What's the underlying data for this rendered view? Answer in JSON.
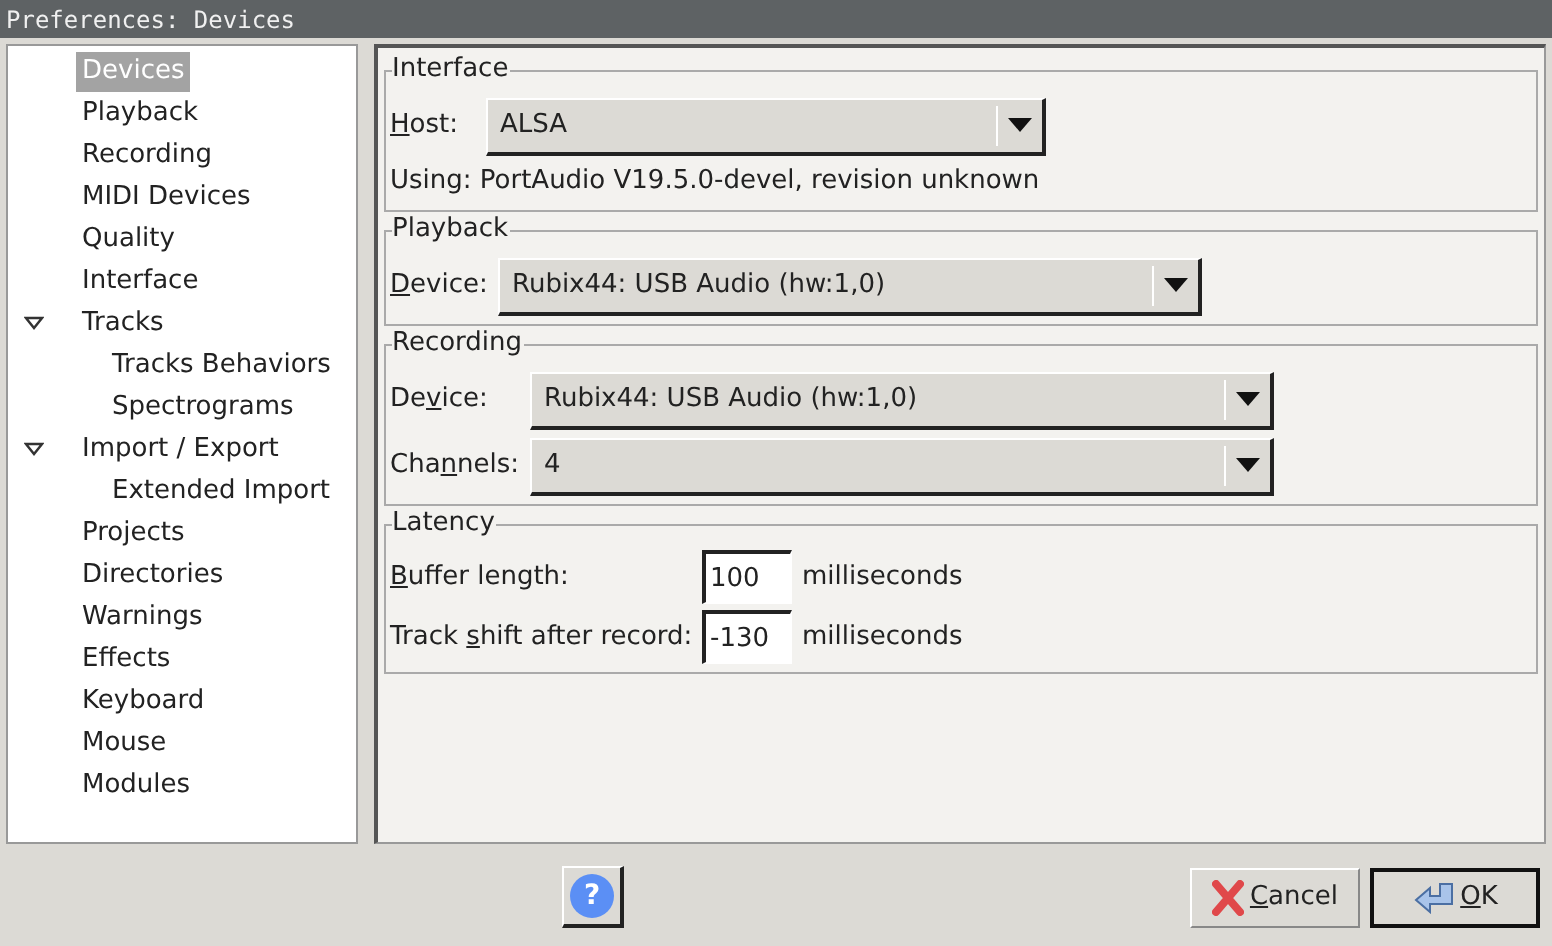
{
  "window": {
    "title": "Preferences: Devices"
  },
  "sidebar": {
    "items": [
      {
        "label": "Devices",
        "selected": true
      },
      {
        "label": "Playback",
        "selected": false
      },
      {
        "label": "Recording",
        "selected": false
      },
      {
        "label": "MIDI Devices",
        "selected": false
      },
      {
        "label": "Quality",
        "selected": false
      },
      {
        "label": "Interface",
        "selected": false
      },
      {
        "label": "Tracks",
        "selected": false,
        "expanded": true,
        "children": [
          {
            "label": "Tracks Behaviors",
            "selected": false
          },
          {
            "label": "Spectrograms",
            "selected": false
          }
        ]
      },
      {
        "label": "Import / Export",
        "selected": false,
        "expanded": true,
        "children": [
          {
            "label": "Extended Import",
            "selected": false
          }
        ]
      },
      {
        "label": "Projects",
        "selected": false
      },
      {
        "label": "Directories",
        "selected": false
      },
      {
        "label": "Warnings",
        "selected": false
      },
      {
        "label": "Effects",
        "selected": false
      },
      {
        "label": "Keyboard",
        "selected": false
      },
      {
        "label": "Mouse",
        "selected": false
      },
      {
        "label": "Modules",
        "selected": false
      }
    ]
  },
  "groups": [
    {
      "title": "Interface",
      "rows": [
        {
          "kind": "dropdown",
          "label": {
            "key": "H",
            "post": "ost:"
          },
          "value": "ALSA"
        },
        {
          "kind": "note",
          "text": "Using: PortAudio V19.5.0-devel, revision unknown"
        }
      ]
    },
    {
      "title": "Playback",
      "rows": [
        {
          "kind": "dropdown",
          "label": {
            "key": "D",
            "post": "evice:"
          },
          "value": "Rubix44: USB Audio (hw:1,0)"
        }
      ]
    },
    {
      "title": "Recording",
      "rows": [
        {
          "kind": "dropdown",
          "label": {
            "pre": "De",
            "key": "v",
            "post": "ice:"
          },
          "value": "Rubix44: USB Audio (hw:1,0)"
        },
        {
          "kind": "dropdown",
          "label": {
            "pre": "Cha",
            "key": "n",
            "post": "nels:"
          },
          "value": "4"
        }
      ]
    },
    {
      "title": "Latency",
      "rows": [
        {
          "kind": "number",
          "label": {
            "key": "B",
            "post": "uffer length:"
          },
          "value": "100",
          "unit": "milliseconds"
        },
        {
          "kind": "number",
          "label": {
            "pre": "Track ",
            "key": "s",
            "post": "hift after record:"
          },
          "value": "-130",
          "unit": "milliseconds"
        }
      ]
    }
  ],
  "buttons": [
    {
      "kind": "help",
      "label": "?"
    },
    {
      "kind": "cancel",
      "label": {
        "key": "C",
        "post": "ancel"
      }
    },
    {
      "kind": "ok",
      "label": {
        "key": "O",
        "post": "K"
      }
    }
  ]
}
